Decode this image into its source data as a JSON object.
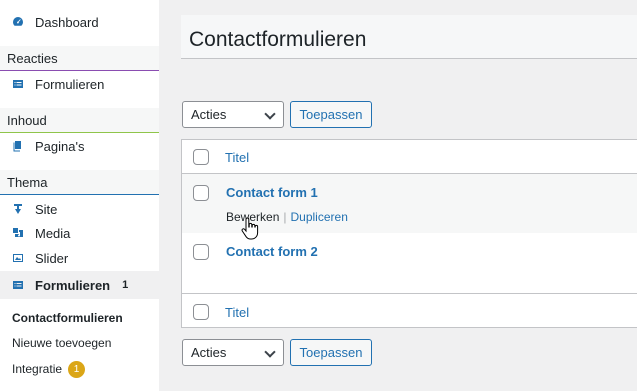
{
  "sidebar": {
    "dashboard": "Dashboard",
    "section_reacties": "Reacties",
    "reacties_color": "#8a4db1",
    "formulieren_item": "Formulieren",
    "section_inhoud": "Inhoud",
    "inhoud_color": "#8fc54a",
    "paginas": "Pagina's",
    "section_thema": "Thema",
    "thema_color": "#2271b1",
    "site": "Site",
    "media": "Media",
    "slider": "Slider",
    "active_menu": "Formulieren",
    "active_count": "1",
    "sub_contactformulieren": "Contactformulieren",
    "sub_nieuwe": "Nieuwe toevoegen",
    "sub_integratie": "Integratie",
    "integratie_badge": "1"
  },
  "main": {
    "page_title": "Contactformulieren",
    "bulk_select_top": "Acties",
    "apply_top": "Toepassen",
    "bulk_select_bottom": "Acties",
    "apply_bottom": "Toepassen",
    "column_title": "Titel",
    "rows": [
      {
        "title": "Contact form 1"
      },
      {
        "title": "Contact form 2"
      }
    ],
    "row_action_edit": "Bewerken",
    "row_action_separator": "|",
    "row_action_duplicate": "Dupliceren",
    "footer_column_title": "Titel"
  },
  "icons": {
    "dashboard": "dashboard-icon",
    "forms": "form-icon",
    "pages": "pages-icon",
    "site": "site-icon",
    "media": "media-icon",
    "slider": "slider-icon",
    "cursor": "hand-pointer-icon"
  },
  "colors": {
    "accent": "#2271b1",
    "badge": "#dba617"
  }
}
